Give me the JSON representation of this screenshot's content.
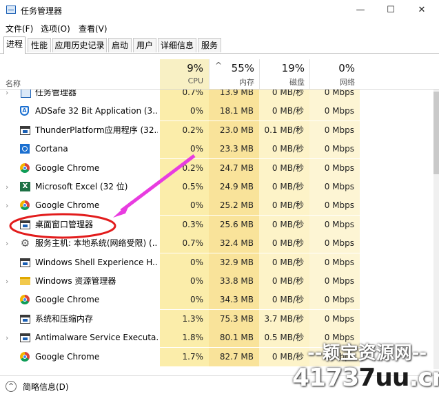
{
  "window": {
    "title": "任务管理器",
    "minimize": "—",
    "maximize": "☐",
    "close": "✕"
  },
  "menu": [
    "文件(F)",
    "选项(O)",
    "查看(V)"
  ],
  "tabs": [
    "进程",
    "性能",
    "应用历史记录",
    "启动",
    "用户",
    "详细信息",
    "服务"
  ],
  "header": {
    "name_label": "名称",
    "sort_caret": "^",
    "cpu": {
      "pct": "9%",
      "label": "CPU"
    },
    "mem": {
      "pct": "55%",
      "label": "内存"
    },
    "disk": {
      "pct": "19%",
      "label": "磁盘"
    },
    "net": {
      "pct": "0%",
      "label": "网络"
    }
  },
  "rows": [
    {
      "name": "任务管理器",
      "cpu": "0.7%",
      "mem": "13.9 MB",
      "disk": "0 MB/秒",
      "net": "0 Mbps",
      "expand": "›",
      "icon": "task-manager-icon"
    },
    {
      "name": "ADSafe 32 Bit Application (3...",
      "cpu": "0%",
      "mem": "18.1 MB",
      "disk": "0 MB/秒",
      "net": "0 Mbps",
      "expand": "",
      "icon": "adsafe-icon"
    },
    {
      "name": "ThunderPlatform应用程序 (32...",
      "cpu": "0.2%",
      "mem": "23.0 MB",
      "disk": "0.1 MB/秒",
      "net": "0 Mbps",
      "expand": "",
      "icon": "app-window-icon"
    },
    {
      "name": "Cortana",
      "cpu": "0%",
      "mem": "23.3 MB",
      "disk": "0 MB/秒",
      "net": "0 Mbps",
      "expand": "",
      "icon": "cortana-icon"
    },
    {
      "name": "Google Chrome",
      "cpu": "0.2%",
      "mem": "24.7 MB",
      "disk": "0 MB/秒",
      "net": "0 Mbps",
      "expand": "",
      "icon": "chrome-icon"
    },
    {
      "name": "Microsoft Excel (32 位)",
      "cpu": "0.5%",
      "mem": "24.9 MB",
      "disk": "0 MB/秒",
      "net": "0 Mbps",
      "expand": "›",
      "icon": "excel-icon"
    },
    {
      "name": "Google Chrome",
      "cpu": "0%",
      "mem": "25.2 MB",
      "disk": "0 MB/秒",
      "net": "0 Mbps",
      "expand": "›",
      "icon": "chrome-icon"
    },
    {
      "name": "桌面窗口管理器",
      "cpu": "0.3%",
      "mem": "25.6 MB",
      "disk": "0 MB/秒",
      "net": "0 Mbps",
      "expand": "",
      "icon": "app-window-icon"
    },
    {
      "name": "服务主机: 本地系统(网络受限) (...",
      "cpu": "0.7%",
      "mem": "32.4 MB",
      "disk": "0 MB/秒",
      "net": "0 Mbps",
      "expand": "›",
      "icon": "gear-icon"
    },
    {
      "name": "Windows Shell Experience H...",
      "cpu": "0%",
      "mem": "32.9 MB",
      "disk": "0 MB/秒",
      "net": "0 Mbps",
      "expand": "",
      "icon": "app-window-icon"
    },
    {
      "name": "Windows 资源管理器",
      "cpu": "0%",
      "mem": "33.8 MB",
      "disk": "0 MB/秒",
      "net": "0 Mbps",
      "expand": "›",
      "icon": "folder-icon"
    },
    {
      "name": "Google Chrome",
      "cpu": "0%",
      "mem": "34.3 MB",
      "disk": "0 MB/秒",
      "net": "0 Mbps",
      "expand": "",
      "icon": "chrome-icon"
    },
    {
      "name": "系统和压缩内存",
      "cpu": "1.3%",
      "mem": "75.3 MB",
      "disk": "3.7 MB/秒",
      "net": "0 Mbps",
      "expand": "",
      "icon": "app-window-icon"
    },
    {
      "name": "Antimalware Service Executa...",
      "cpu": "1.8%",
      "mem": "80.1 MB",
      "disk": "0.5 MB/秒",
      "net": "0 Mbps",
      "expand": "›",
      "icon": "app-window-icon"
    },
    {
      "name": "Google Chrome",
      "cpu": "1.7%",
      "mem": "82.7 MB",
      "disk": "0 MB/秒",
      "net": "0 Mbps",
      "expand": "",
      "icon": "chrome-icon"
    }
  ],
  "footer": {
    "label": "简略信息(D)",
    "icon": "chevron-up-icon"
  },
  "watermark": {
    "line1": "--颖宝资源网--",
    "line2_a": "4173",
    "line2_b": "7uu",
    "line2_c": ".cn"
  },
  "colors": {
    "cpu_highlight": "#fbedaa",
    "mem_highlight": "#f9e39a",
    "disk_highlight": "#fdf3c8",
    "net_highlight": "#fdf5d4",
    "annotation": "#e83ce0",
    "circle": "#e21c1c"
  }
}
